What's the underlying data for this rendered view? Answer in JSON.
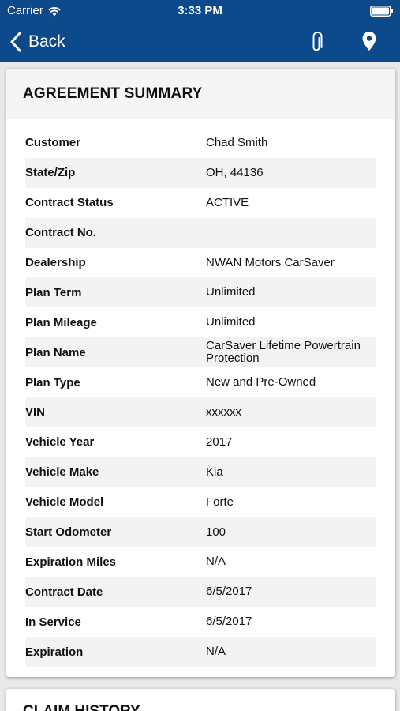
{
  "status_bar": {
    "carrier": "Carrier",
    "time": "3:33 PM",
    "wifi_icon": "wifi-icon",
    "battery_icon": "battery-icon"
  },
  "nav": {
    "back_label": "Back",
    "attach_icon": "paperclip-icon",
    "location_icon": "map-pin-icon",
    "background_color": "#0d4a8b"
  },
  "summary": {
    "title": "AGREEMENT SUMMARY",
    "rows": [
      {
        "label": "Customer",
        "value": "Chad Smith"
      },
      {
        "label": "State/Zip",
        "value": "OH, 44136"
      },
      {
        "label": "Contract Status",
        "value": "ACTIVE"
      },
      {
        "label": "Contract No.",
        "value": ""
      },
      {
        "label": "Dealership",
        "value": "NWAN Motors CarSaver"
      },
      {
        "label": "Plan Term",
        "value": "Unlimited"
      },
      {
        "label": "Plan Mileage",
        "value": "Unlimited"
      },
      {
        "label": "Plan Name",
        "value": "CarSaver Lifetime Powertrain Protection"
      },
      {
        "label": "Plan Type",
        "value": "New and Pre-Owned"
      },
      {
        "label": "VIN",
        "value": "xxxxxx"
      },
      {
        "label": "Vehicle Year",
        "value": "2017"
      },
      {
        "label": "Vehicle Make",
        "value": "Kia"
      },
      {
        "label": "Vehicle Model",
        "value": "Forte"
      },
      {
        "label": "Start Odometer",
        "value": "100"
      },
      {
        "label": "Expiration Miles",
        "value": "N/A"
      },
      {
        "label": "Contract Date",
        "value": "6/5/2017"
      },
      {
        "label": "In Service",
        "value": "6/5/2017"
      },
      {
        "label": "Expiration",
        "value": "N/A"
      }
    ]
  },
  "claims": {
    "title": "CLAIM HISTORY"
  }
}
